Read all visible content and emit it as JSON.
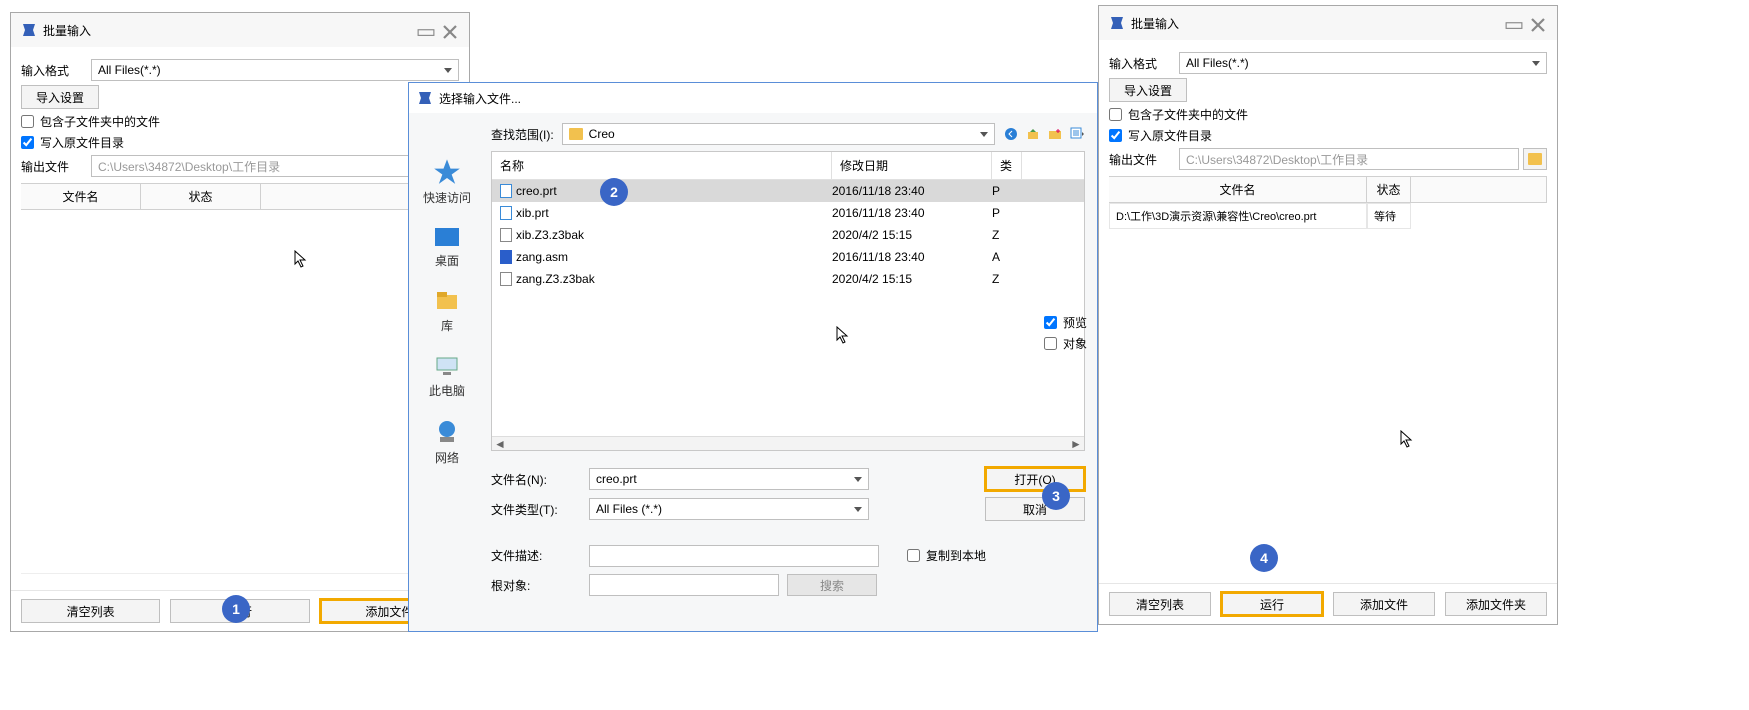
{
  "app_icon_color": "#3460b8",
  "panel1": {
    "title": "批量输入",
    "format_label": "输入格式",
    "format_value": "All Files(*.*)",
    "import_settings_btn": "导入设置",
    "include_subfolders_label": "包含子文件夹中的文件",
    "include_subfolders_checked": false,
    "write_orig_dir_label": "写入原文件目录",
    "write_orig_dir_checked": true,
    "output_file_label": "输出文件",
    "output_file_value": "C:\\Users\\34872\\Desktop\\工作目录",
    "col_filename": "文件名",
    "col_status": "状态",
    "btn_clear": "清空列表",
    "btn_run": "运行",
    "btn_addfile": "添加文件"
  },
  "dialog": {
    "title": "选择输入文件...",
    "lookin_label": "查找范围(I):",
    "lookin_value": "Creo",
    "sidebar": {
      "quick": "快速访问",
      "desktop": "桌面",
      "library": "库",
      "thispc": "此电脑",
      "network": "网络"
    },
    "columns": {
      "name": "名称",
      "date": "修改日期",
      "type": "类"
    },
    "files": [
      {
        "name": "creo.prt",
        "date": "2016/11/18 23:40",
        "type": "P",
        "selected": true,
        "icon": "file"
      },
      {
        "name": "xib.prt",
        "date": "2016/11/18 23:40",
        "type": "P",
        "selected": false,
        "icon": "file"
      },
      {
        "name": "xib.Z3.z3bak",
        "date": "2020/4/2 15:15",
        "type": "Z",
        "selected": false,
        "icon": "doc"
      },
      {
        "name": "zang.asm",
        "date": "2016/11/18 23:40",
        "type": "A",
        "selected": false,
        "icon": "blue"
      },
      {
        "name": "zang.Z3.z3bak",
        "date": "2020/4/2 15:15",
        "type": "Z",
        "selected": false,
        "icon": "doc"
      }
    ],
    "filename_label": "文件名(N):",
    "filename_value": "creo.prt",
    "filetype_label": "文件类型(T):",
    "filetype_value": "All Files (*.*)",
    "open_btn": "打开(O)",
    "cancel_btn": "取消",
    "filedesc_label": "文件描述:",
    "rootobj_label": "根对象:",
    "search_btn": "搜索",
    "copy_local_label": "复制到本地",
    "copy_local_checked": false
  },
  "sidestrip": {
    "preview_label": "预览",
    "preview_checked": true,
    "object_label": "对象",
    "object_checked": false
  },
  "panel3": {
    "title": "批量输入",
    "format_label": "输入格式",
    "format_value": "All Files(*.*)",
    "import_settings_btn": "导入设置",
    "include_subfolders_label": "包含子文件夹中的文件",
    "include_subfolders_checked": false,
    "write_orig_dir_label": "写入原文件目录",
    "write_orig_dir_checked": true,
    "output_file_label": "输出文件",
    "output_file_value": "C:\\Users\\34872\\Desktop\\工作目录",
    "col_filename": "文件名",
    "col_status": "状态",
    "row1_path": "D:\\工作\\3D演示资源\\兼容性\\Creo\\creo.prt",
    "row1_status": "等待",
    "btn_clear": "清空列表",
    "btn_run": "运行",
    "btn_addfile": "添加文件",
    "btn_addfolder": "添加文件夹"
  },
  "steps": {
    "s1": "1",
    "s2": "2",
    "s3": "3",
    "s4": "4"
  }
}
